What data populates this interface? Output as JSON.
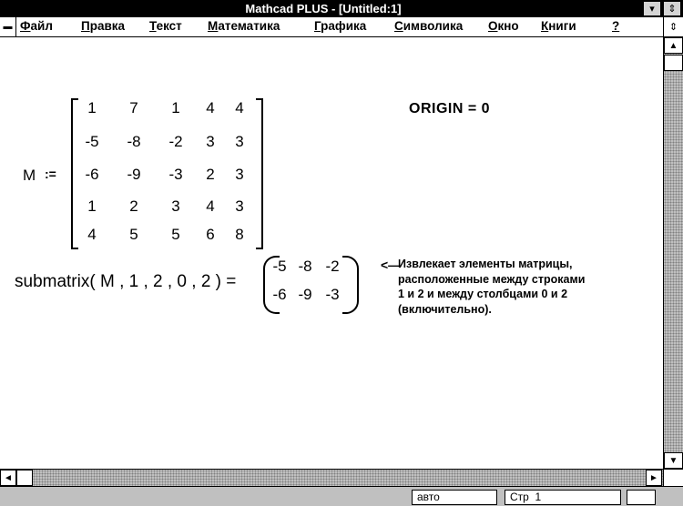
{
  "window": {
    "title": "Mathcad PLUS - [Untitled:1]",
    "restore_glyph": "⇕",
    "minimize_glyph": "▾"
  },
  "menu": {
    "items": [
      {
        "key": "Ф",
        "rest": "айл"
      },
      {
        "key": "П",
        "rest": "равка"
      },
      {
        "key": "Т",
        "rest": "екст"
      },
      {
        "key": "М",
        "rest": "атематика"
      },
      {
        "key": "Г",
        "rest": "рафика"
      },
      {
        "key": "С",
        "rest": "имволика"
      },
      {
        "key": "О",
        "rest": "кно"
      },
      {
        "key": "К",
        "rest": "ниги"
      },
      {
        "key": "?",
        "rest": ""
      }
    ]
  },
  "worksheet": {
    "matrix_name": "M",
    "assign_op": ":=",
    "matrix": [
      [
        "1",
        "7",
        "1",
        "4",
        "4"
      ],
      [
        "-5",
        "-8",
        "-2",
        "3",
        "3"
      ],
      [
        "-6",
        "-9",
        "-3",
        "2",
        "3"
      ],
      [
        "1",
        "2",
        "3",
        "4",
        "3"
      ],
      [
        "4",
        "5",
        "5",
        "6",
        "8"
      ]
    ],
    "origin": "ORIGIN = 0",
    "submatrix_expr": "submatrix( M , 1 , 2 , 0 , 2 )  =",
    "result": [
      [
        "-5",
        "-8",
        "-2"
      ],
      [
        "-6",
        "-9",
        "-3"
      ]
    ],
    "arrow": "<—",
    "note_lines": [
      "Извлекает элементы матрицы,",
      "расположенные между строками",
      "1 и 2 и между столбцами 0 и 2",
      "(включительно)."
    ]
  },
  "status": {
    "mode": "авто",
    "page_label": "Стр",
    "page_number": "1"
  }
}
